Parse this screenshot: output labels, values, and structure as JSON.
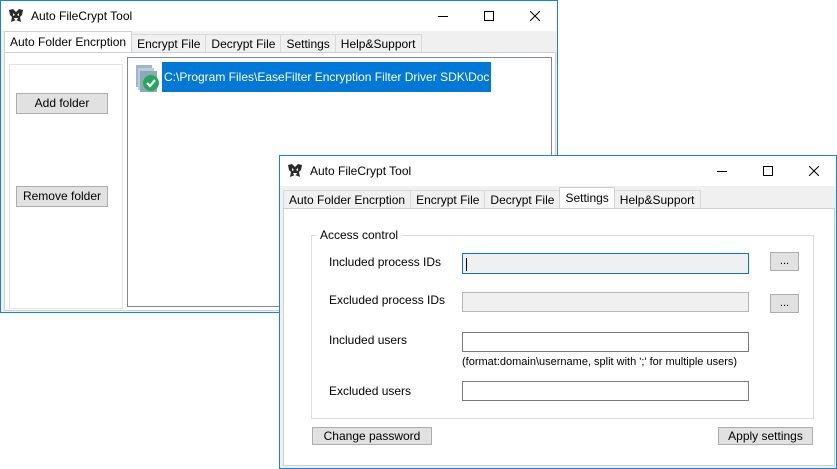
{
  "windows": {
    "back": {
      "title": "Auto FileCrypt Tool",
      "tabs": [
        "Auto Folder Encrption",
        "Encrypt File",
        "Decrypt File",
        "Settings",
        "Help&Support"
      ],
      "active_tab": 0,
      "add_folder_label": "Add folder",
      "remove_folder_label": "Remove folder",
      "folder_path": "C:\\Program Files\\EaseFilter Encryption Filter Driver SDK\\Doc"
    },
    "front": {
      "title": "Auto FileCrypt Tool",
      "tabs": [
        "Auto Folder Encrption",
        "Encrypt File",
        "Decrypt File",
        "Settings",
        "Help&Support"
      ],
      "active_tab": 3,
      "group_title": "Access control",
      "included_pids_label": "Included process IDs",
      "excluded_pids_label": "Excluded process IDs",
      "included_users_label": "Included users",
      "excluded_users_label": "Excluded users",
      "users_hint": "(format:domain\\username, split with ';' for multiple users)",
      "browse_label": "...",
      "change_password_label": "Change password",
      "apply_settings_label": "Apply settings",
      "included_pids_value": "",
      "excluded_pids_value": "",
      "included_users_value": "",
      "excluded_users_value": ""
    }
  },
  "colors": {
    "accent": "#0078d7",
    "window_border": "#1883d7",
    "selection": "#0078d7"
  },
  "icons": [
    "app-transformer-icon",
    "minimize-icon",
    "maximize-icon",
    "close-icon",
    "folder-encrypted-icon"
  ]
}
